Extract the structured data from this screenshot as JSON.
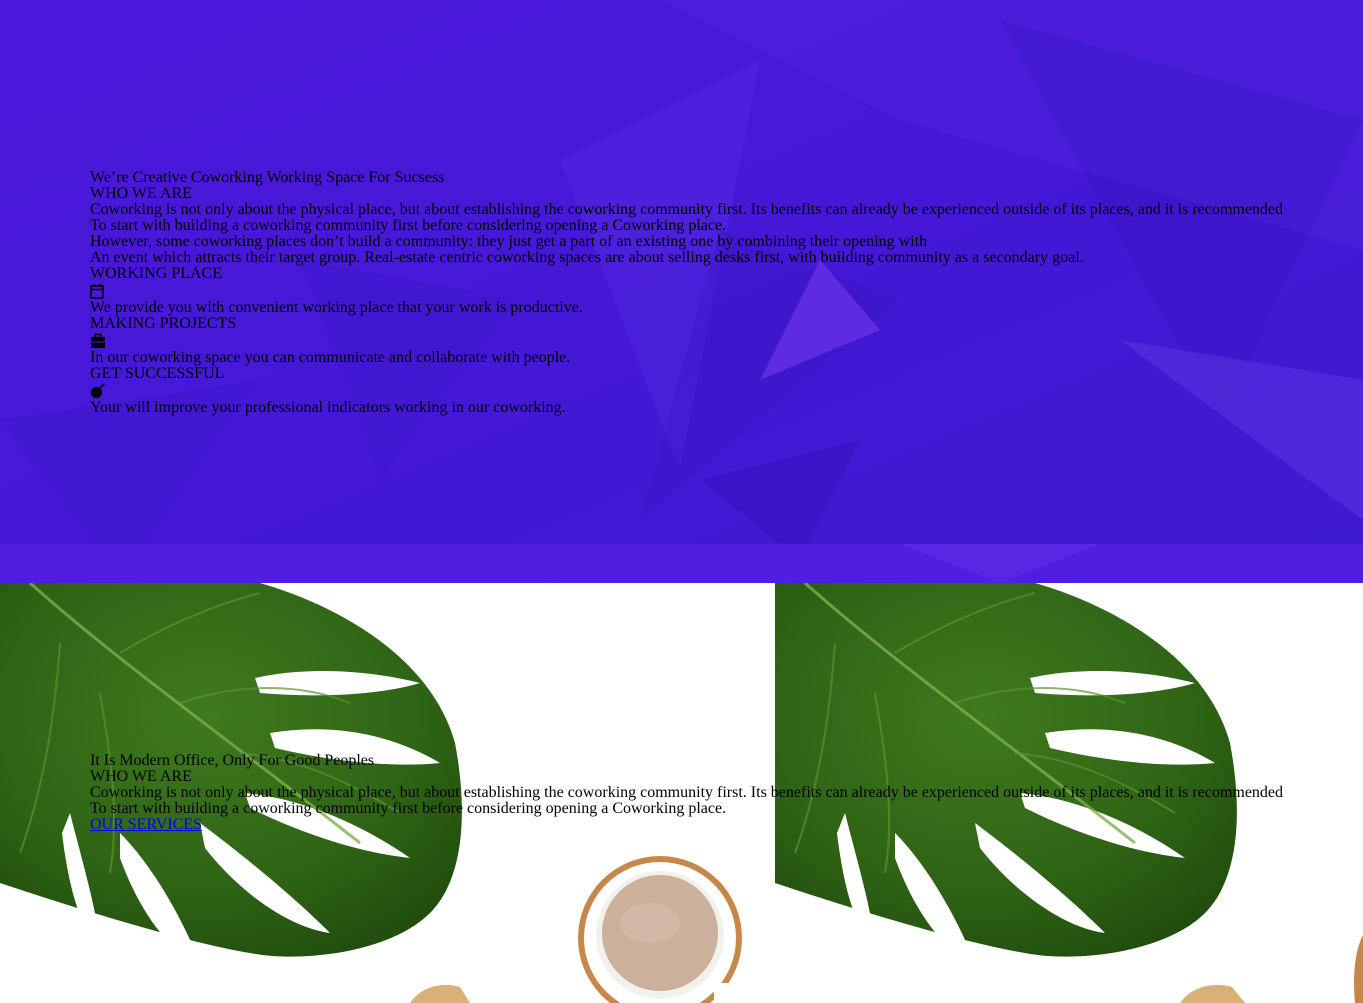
{
  "colors": {
    "hero_background": "#4a1ad8",
    "link": "#0000ee",
    "text": "#000000"
  },
  "hero": {
    "tagline": "We’re Creative Coworking Working Space For Sucsess",
    "heading": "WHO WE ARE",
    "paragraphs": [
      "Coworking is not only about the physical place, but about establishing the coworking community first. Its benefits can already be experienced outside of its places, and it is recommended",
      "To start with building a coworking community first before considering opening a Coworking place.",
      "However, some coworking places don’t build a community: they just get a part of an existing one by combining their opening with",
      "An event which attracts their target group. Real-estate centric coworking spaces are about selling desks first, with building community as a secondary goal."
    ],
    "features": [
      {
        "title": "WORKING PLACE",
        "icon": "calendar-icon",
        "text": "We provide you with convenient working place that your work is productive."
      },
      {
        "title": "MAKING PROJECTS",
        "icon": "briefcase-icon",
        "text": "In our coworking space you can communicate and collaborate with people."
      },
      {
        "title": "GET SUCCESSFUL",
        "icon": "bomb-icon",
        "text": "Your will improve your professional indicators working in our coworking."
      }
    ]
  },
  "about": {
    "tagline": "It Is Modern Office, Only For Good Peoples",
    "heading": "WHO WE ARE",
    "paragraphs": [
      "Coworking is not only about the physical place, but about establishing the coworking community first. Its benefits can already be experienced outside of its places, and it is recommended",
      "To start with building a coworking community first before considering opening a Coworking place."
    ],
    "link_label": "OUR SERVICES"
  }
}
